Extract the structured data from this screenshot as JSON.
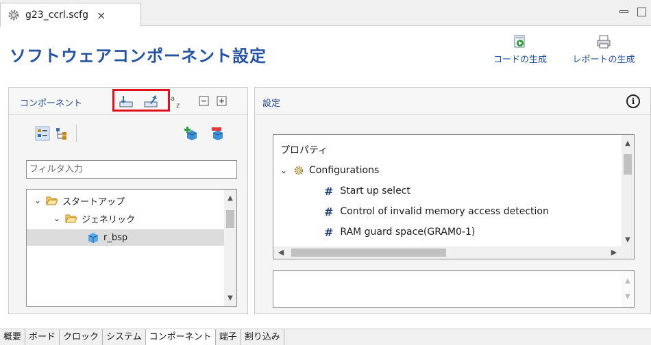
{
  "editor_tab": {
    "title": "g23_ccrl.scfg",
    "close_glyph": "×"
  },
  "header": {
    "title": "ソフトウェアコンポーネント設定",
    "generate_code_label": "コードの生成",
    "generate_report_label": "レポートの生成"
  },
  "components_panel": {
    "title": "コンポーネント",
    "filter_placeholder": "フィルタ入力",
    "tree": [
      {
        "label": "スタートアップ",
        "expanded": true
      },
      {
        "label": "ジェネリック",
        "expanded": true
      },
      {
        "label": "r_bsp",
        "selected": true
      }
    ]
  },
  "settings_panel": {
    "title": "設定",
    "info_glyph": "i",
    "property_header": "プロパティ",
    "group_label": "Configurations",
    "properties": [
      "Start up select",
      "Control of invalid memory access detection",
      "RAM guard space(GRAM0-1)"
    ]
  },
  "bottom_tabs": [
    {
      "label": "概要"
    },
    {
      "label": "ボード"
    },
    {
      "label": "クロック"
    },
    {
      "label": "システム"
    },
    {
      "label": "コンポーネント",
      "active": true
    },
    {
      "label": "端子"
    },
    {
      "label": "割り込み"
    }
  ],
  "colors": {
    "accent": "#2552a0",
    "highlight": "#e0101c",
    "selection": "#dcdcdc"
  }
}
